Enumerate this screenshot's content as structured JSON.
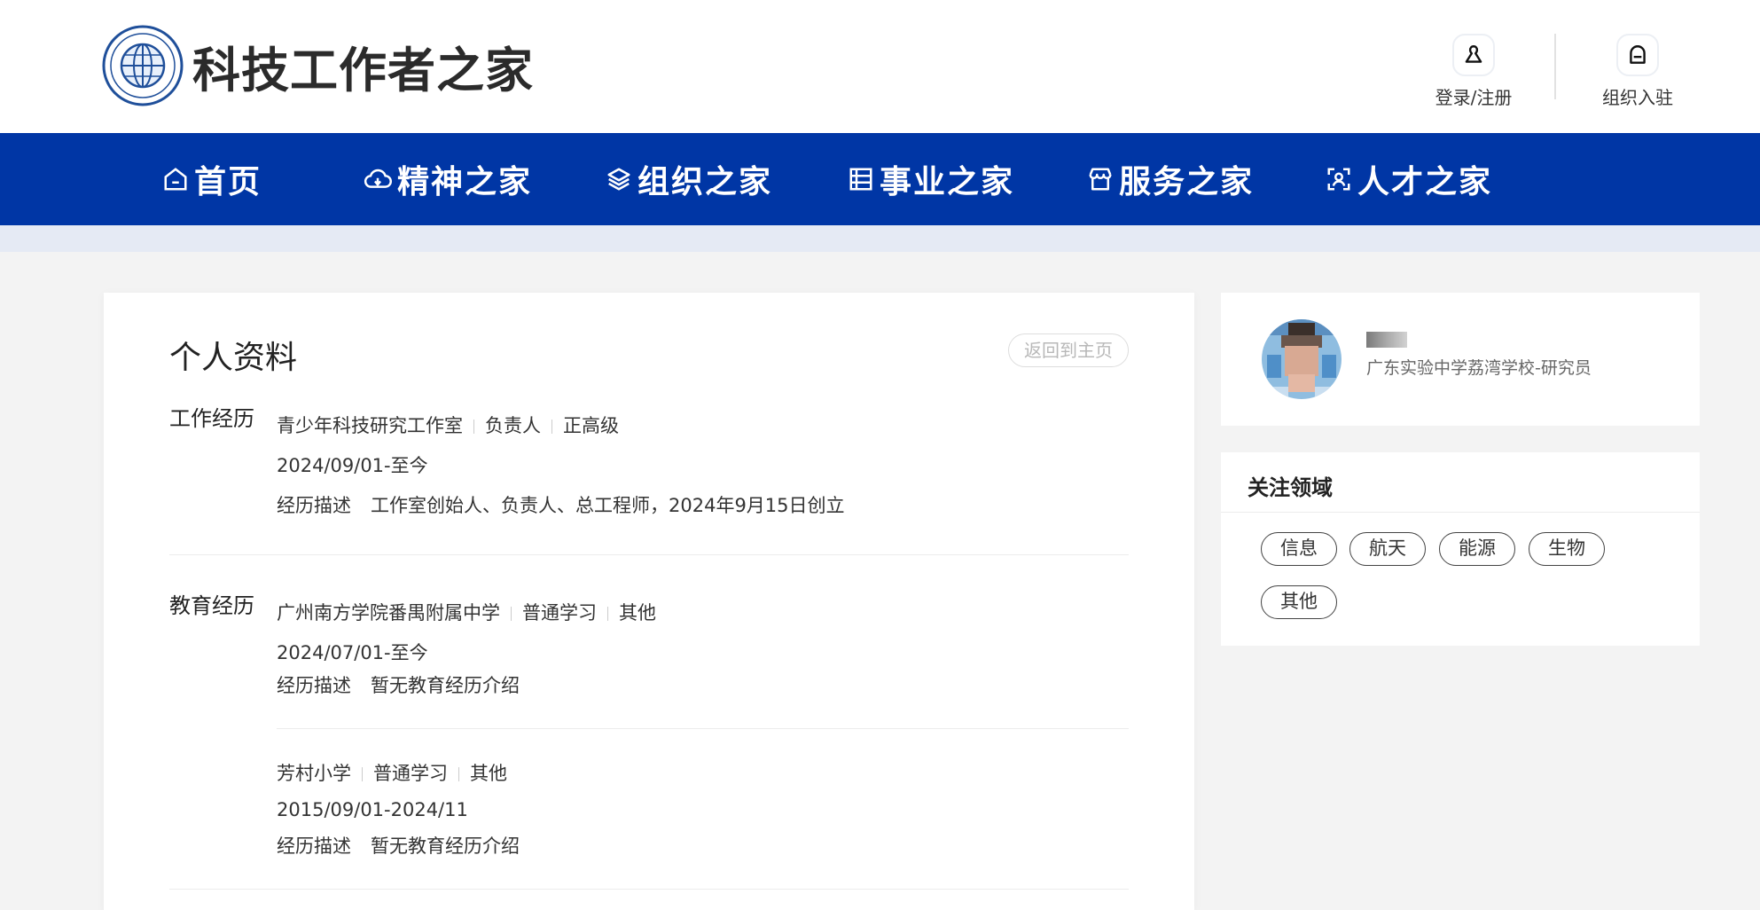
{
  "header": {
    "site_title": "科技工作者之家",
    "login_label": "登录/注册",
    "org_label": "组织入驻"
  },
  "nav": {
    "items": [
      {
        "label": "首页",
        "icon": "home-icon"
      },
      {
        "label": "精神之家",
        "icon": "cloud-icon"
      },
      {
        "label": "组织之家",
        "icon": "layers-icon"
      },
      {
        "label": "事业之家",
        "icon": "list-icon"
      },
      {
        "label": "服务之家",
        "icon": "store-icon"
      },
      {
        "label": "人才之家",
        "icon": "person-scan-icon"
      }
    ]
  },
  "main": {
    "title": "个人资料",
    "back_label": "返回到主页",
    "work": {
      "label": "工作经历",
      "org": "青少年科技研究工作室",
      "role": "负责人",
      "level": "正高级",
      "period": "2024/09/01-至今",
      "desc_label": "经历描述",
      "desc": "工作室创始人、负责人、总工程师，2024年9月15日创立"
    },
    "education": {
      "label": "教育经历",
      "entries": [
        {
          "school": "广州南方学院番禺附属中学",
          "type": "普通学习",
          "degree": "其他",
          "period": "2024/07/01-至今",
          "desc_label": "经历描述",
          "desc": "暂无教育经历介绍"
        },
        {
          "school": "芳村小学",
          "type": "普通学习",
          "degree": "其他",
          "period": "2015/09/01-2024/11",
          "desc_label": "经历描述",
          "desc": "暂无教育经历介绍"
        }
      ]
    }
  },
  "profile": {
    "subtitle": "广东实验中学荔湾学校-研究员"
  },
  "interests": {
    "title": "关注领域",
    "tags": [
      "信息",
      "航天",
      "能源",
      "生物",
      "其他"
    ]
  },
  "colors": {
    "nav_bg": "#0036a5",
    "subbar_bg": "#e5eaf4",
    "page_bg": "#f3f3f3"
  }
}
